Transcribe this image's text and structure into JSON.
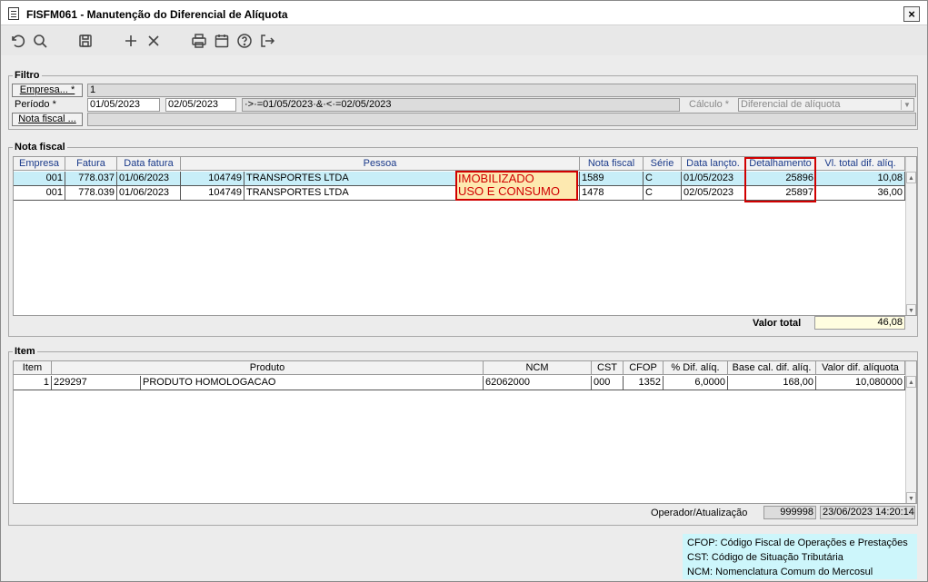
{
  "window": {
    "title": "FISFM061 - Manutenção do Diferencial de Alíquota",
    "close": "×"
  },
  "toolbar": {
    "icons": [
      "undo-icon",
      "search-icon",
      "save-icon",
      "add-icon",
      "delete-icon",
      "print-icon",
      "calendar-icon",
      "help-icon",
      "exit-icon"
    ]
  },
  "filtro": {
    "legend": "Filtro",
    "empresa_button": "Empresa... *",
    "empresa_value": "1",
    "periodo_label": "Período *",
    "periodo_start": "01/05/2023",
    "periodo_end": "02/05/2023",
    "periodo_expr": "·>·=01/05/2023·&·<·=02/05/2023",
    "calculo_label": "Cálculo *",
    "calculo_value": "Diferencial de alíquota",
    "nota_button": "Nota fiscal ...",
    "nota_value": ""
  },
  "nota_fiscal": {
    "legend": "Nota fiscal",
    "columns": [
      "Empresa",
      "Fatura",
      "Data fatura",
      "Pessoa",
      "Nota fiscal",
      "Série",
      "Data lançto.",
      "Detalhamento",
      "Vl. total dif. alíq."
    ],
    "rows": [
      {
        "empresa": "001",
        "fatura": "778.037",
        "data_fatura": "01/06/2023",
        "pessoa_cod": "104749",
        "pessoa_nome": "TRANSPORTES LTDA",
        "nota": "1589",
        "serie": "C",
        "data_lancto": "01/05/2023",
        "detalhamento": "25896",
        "vl_total": "10,08"
      },
      {
        "empresa": "001",
        "fatura": "778.039",
        "data_fatura": "01/06/2023",
        "pessoa_cod": "104749",
        "pessoa_nome": "TRANSPORTES LTDA",
        "nota": "1478",
        "serie": "C",
        "data_lancto": "02/05/2023",
        "detalhamento": "25897",
        "vl_total": "36,00"
      }
    ],
    "annotation_line1": "IMOBILIZADO",
    "annotation_line2": "USO E CONSUMO",
    "valor_total_label": "Valor total",
    "valor_total": "46,08"
  },
  "item": {
    "legend": "Item",
    "columns": [
      "Item",
      "Produto",
      "NCM",
      "CST",
      "CFOP",
      "% Dif. alíq.",
      "Base cal. dif. alíq.",
      "Valor dif. alíquota"
    ],
    "rows": [
      {
        "item": "1",
        "produto_cod": "229297",
        "produto_nome": "PRODUTO HOMOLOGACAO",
        "ncm": "62062000",
        "cst": "000",
        "cfop": "1352",
        "pct": "6,0000",
        "base": "168,00",
        "valor": "10,080000"
      }
    ],
    "operador_label": "Operador/Atualização",
    "operador": "999998",
    "atualizacao": "23/06/2023 14:20:14"
  },
  "legend_notes": [
    "CFOP: Código Fiscal de Operações e Prestações",
    "CST: Código de Situação Tributária",
    "NCM: Nomenclatura Comum do Mercosul"
  ],
  "colors": {
    "highlight_row": "#c8eef8",
    "annotation_bg": "#fde9b0",
    "annotation_text": "#d00000",
    "legend_bg": "#cdf6fb",
    "total_bg": "#fffde0"
  }
}
